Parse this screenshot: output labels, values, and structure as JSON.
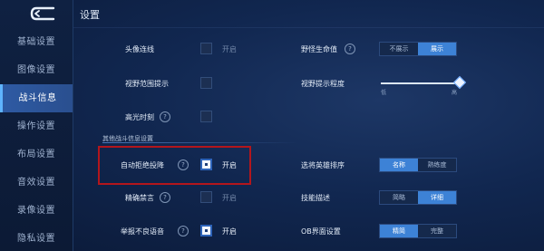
{
  "header": {
    "title": "设置"
  },
  "sidebar": {
    "items": [
      {
        "label": "基础设置"
      },
      {
        "label": "图像设置"
      },
      {
        "label": "战斗信息"
      },
      {
        "label": "操作设置"
      },
      {
        "label": "布局设置"
      },
      {
        "label": "音效设置"
      },
      {
        "label": "录像设置"
      },
      {
        "label": "隐私设置"
      }
    ],
    "active_index": 2
  },
  "colors": {
    "accent": "#3d82d6",
    "highlight": "#b3161c"
  },
  "left_settings": [
    {
      "label": "头像连线",
      "checked": false,
      "state_label": "开启"
    },
    {
      "label": "视野范围提示",
      "checked": false,
      "state_label": ""
    },
    {
      "label": "高光时刻",
      "checked": false,
      "state_label": "",
      "help": "?"
    },
    {
      "label": "自动拒绝投降",
      "checked": true,
      "state_label": "开启",
      "help": "?"
    },
    {
      "label": "精确禁言",
      "checked": false,
      "state_label": "开启",
      "help": "?"
    },
    {
      "label": "举报不良语音",
      "checked": true,
      "state_label": "开启",
      "help": "?"
    }
  ],
  "section": {
    "title": "其他战斗信息设置"
  },
  "right_settings": {
    "monster_hp": {
      "label": "野怪生命值",
      "help": "?",
      "options": [
        "不展示",
        "展示"
      ],
      "selected": 1
    },
    "vision_level": {
      "label": "视野提示程度",
      "min_label": "低",
      "max_label": "高",
      "value": 1.0
    },
    "hero_sort": {
      "label": "选将英雄排序",
      "options": [
        "名称",
        "熟练度"
      ],
      "selected": 0
    },
    "skill_desc": {
      "label": "技能描述",
      "options": [
        "简略",
        "详细"
      ],
      "selected": 1
    },
    "ob_ui": {
      "label": "OB界面设置",
      "options": [
        "精简",
        "完整"
      ],
      "selected": 0
    }
  }
}
